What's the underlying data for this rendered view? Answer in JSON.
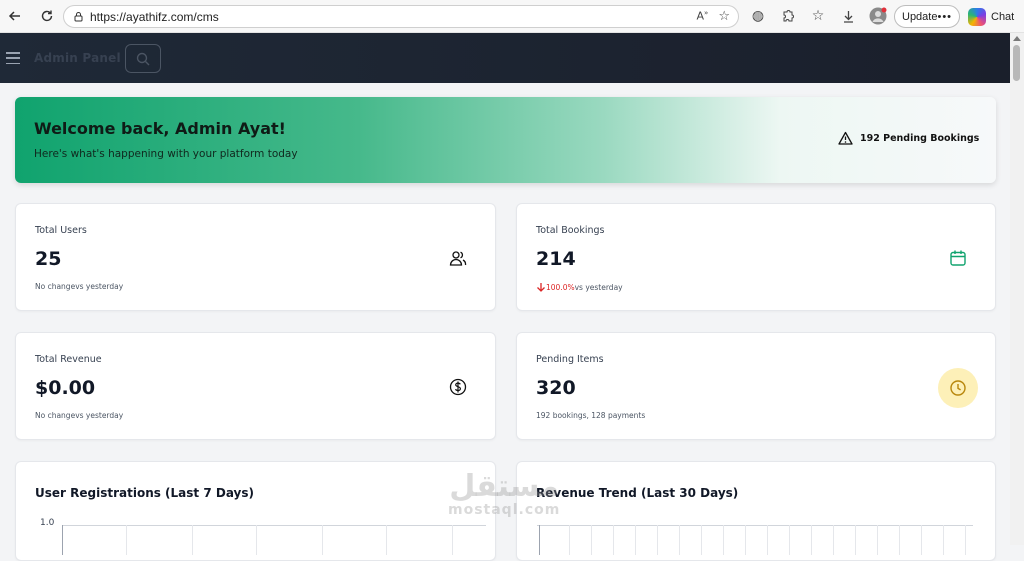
{
  "browser": {
    "url": "https://ayathifz.com/cms",
    "update_label": "Update",
    "chat_label": "Chat"
  },
  "header": {
    "title": "Admin Panel"
  },
  "welcome": {
    "title": "Welcome back, Admin Ayat!",
    "subtitle": "Here's what's happening with your platform today",
    "pending_bookings": "192 Pending Bookings"
  },
  "stats": {
    "users": {
      "label": "Total Users",
      "value": "25",
      "change": "No change",
      "suffix": "vs yesterday",
      "icon": "users-icon"
    },
    "bookings": {
      "label": "Total Bookings",
      "value": "214",
      "change": "100.0%",
      "suffix": "vs yesterday",
      "icon": "calendar-icon"
    },
    "revenue": {
      "label": "Total Revenue",
      "value": "$0.00",
      "change": "No change",
      "suffix": "vs yesterday",
      "icon": "dollar-icon"
    },
    "pending": {
      "label": "Pending Items",
      "value": "320",
      "detail": "192 bookings, 128 payments",
      "icon": "clock-icon"
    }
  },
  "charts": {
    "registrations": {
      "title": "User Registrations (Last 7 Days)",
      "y_tick": "1.0"
    },
    "revenue": {
      "title": "Revenue Trend (Last 30 Days)"
    }
  },
  "watermark": {
    "arabic": "مستقل",
    "latin": "mostaql.com"
  },
  "colors": {
    "accent": "#10a36e",
    "danger": "#dc2626",
    "warning_bg": "#fdf0b8"
  }
}
